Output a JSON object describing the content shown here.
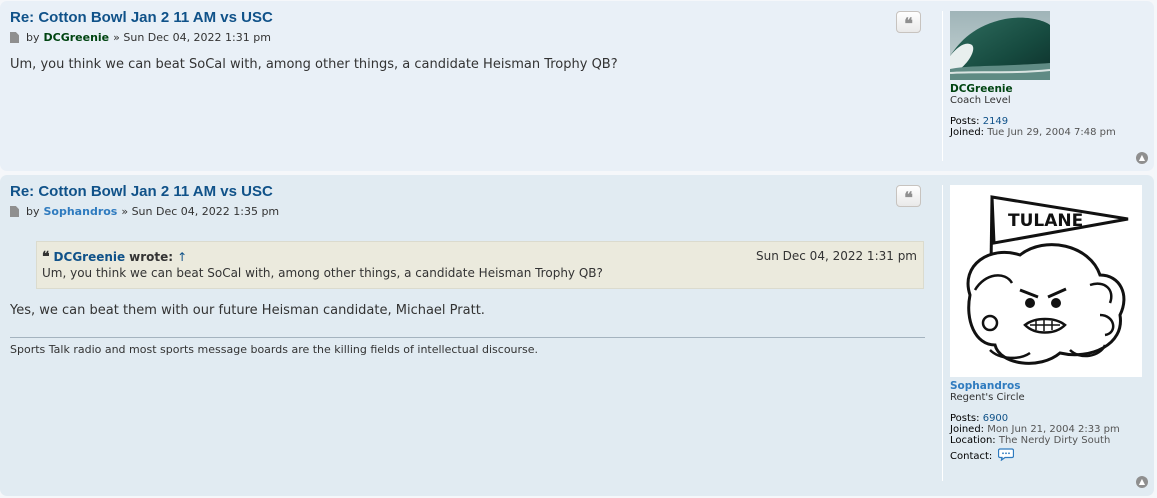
{
  "posts": [
    {
      "title": "Re: Cotton Bowl Jan 2 11 AM vs USC",
      "by": "by",
      "author": "DCGreenie",
      "date": "» Sun Dec 04, 2022 1:31 pm",
      "body": "Um, you think we can beat SoCal with, among other things, a candidate Heisman Trophy QB?",
      "profile": {
        "username": "DCGreenie",
        "rank": "Coach Level",
        "posts_label": "Posts:",
        "posts_value": "2149",
        "joined_label": "Joined:",
        "joined_value": "Tue Jun 29, 2004 7:48 pm"
      },
      "avatar_icon": "ocean-wave-avatar"
    },
    {
      "title": "Re: Cotton Bowl Jan 2 11 AM vs USC",
      "by": "by",
      "author": "Sophandros",
      "date": "» Sun Dec 04, 2022 1:35 pm",
      "quote": {
        "author": "DCGreenie",
        "wrote": "wrote:",
        "arrow": "↑",
        "date": "Sun Dec 04, 2022 1:31 pm",
        "text": "Um, you think we can beat SoCal with, among other things, a candidate Heisman Trophy QB?"
      },
      "body": "Yes, we can beat them with our future Heisman candidate, Michael Pratt.",
      "signature": "Sports Talk radio and most sports message boards are the killing fields of intellectual discourse.",
      "profile": {
        "username": "Sophandros",
        "rank": "Regent's Circle",
        "posts_label": "Posts:",
        "posts_value": "6900",
        "joined_label": "Joined:",
        "joined_value": "Mon Jun 21, 2004 2:33 pm",
        "location_label": "Location:",
        "location_value": "The Nerdy Dirty South",
        "contact_label": "Contact:"
      },
      "avatar_text": "TULANE",
      "avatar_icon": "tulane-wave-mascot-avatar"
    }
  ],
  "icons": {
    "quote": "quote-icon",
    "post_link": "document-icon",
    "top": "arrow-up-circle-icon",
    "contact": "speech-bubble-icon"
  }
}
